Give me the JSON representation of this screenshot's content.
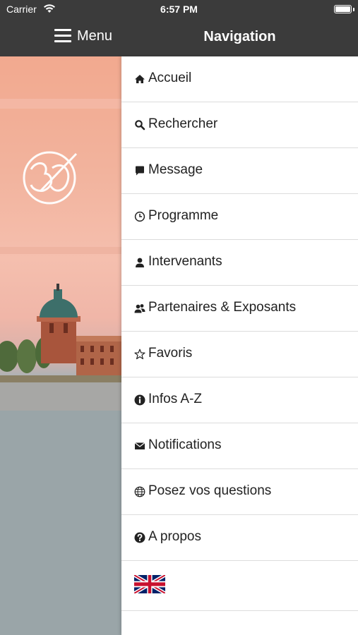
{
  "status_bar": {
    "carrier": "Carrier",
    "time": "6:57 PM",
    "wifi_icon": "wifi-icon",
    "battery_icon": "battery-icon"
  },
  "header": {
    "menu_label": "Menu",
    "menu_icon": "hamburger-icon",
    "title": "Navigation"
  },
  "background": {
    "logo_icon": "event-logo-icon",
    "description_colors": {
      "sky": "#f2b39d",
      "water": "#9aa6aa",
      "dome": "#3d6f6a",
      "brick": "#a8553c"
    }
  },
  "nav": {
    "items": [
      {
        "label": "Accueil",
        "icon": "home-icon"
      },
      {
        "label": "Rechercher",
        "icon": "search-icon"
      },
      {
        "label": "Message",
        "icon": "message-icon"
      },
      {
        "label": "Programme",
        "icon": "clock-icon"
      },
      {
        "label": "Intervenants",
        "icon": "user-icon"
      },
      {
        "label": "Partenaires & Exposants",
        "icon": "users-icon"
      },
      {
        "label": "Favoris",
        "icon": "star-icon"
      },
      {
        "label": "Infos A-Z",
        "icon": "info-icon"
      },
      {
        "label": "Notifications",
        "icon": "envelope-icon"
      },
      {
        "label": "Posez vos questions",
        "icon": "globe-icon"
      },
      {
        "label": "A propos",
        "icon": "question-icon"
      }
    ],
    "language_icon": "uk-flag-icon"
  },
  "colors": {
    "header_bg": "#3b3b3b",
    "text": "#222222",
    "divider": "#dcdcdc"
  }
}
